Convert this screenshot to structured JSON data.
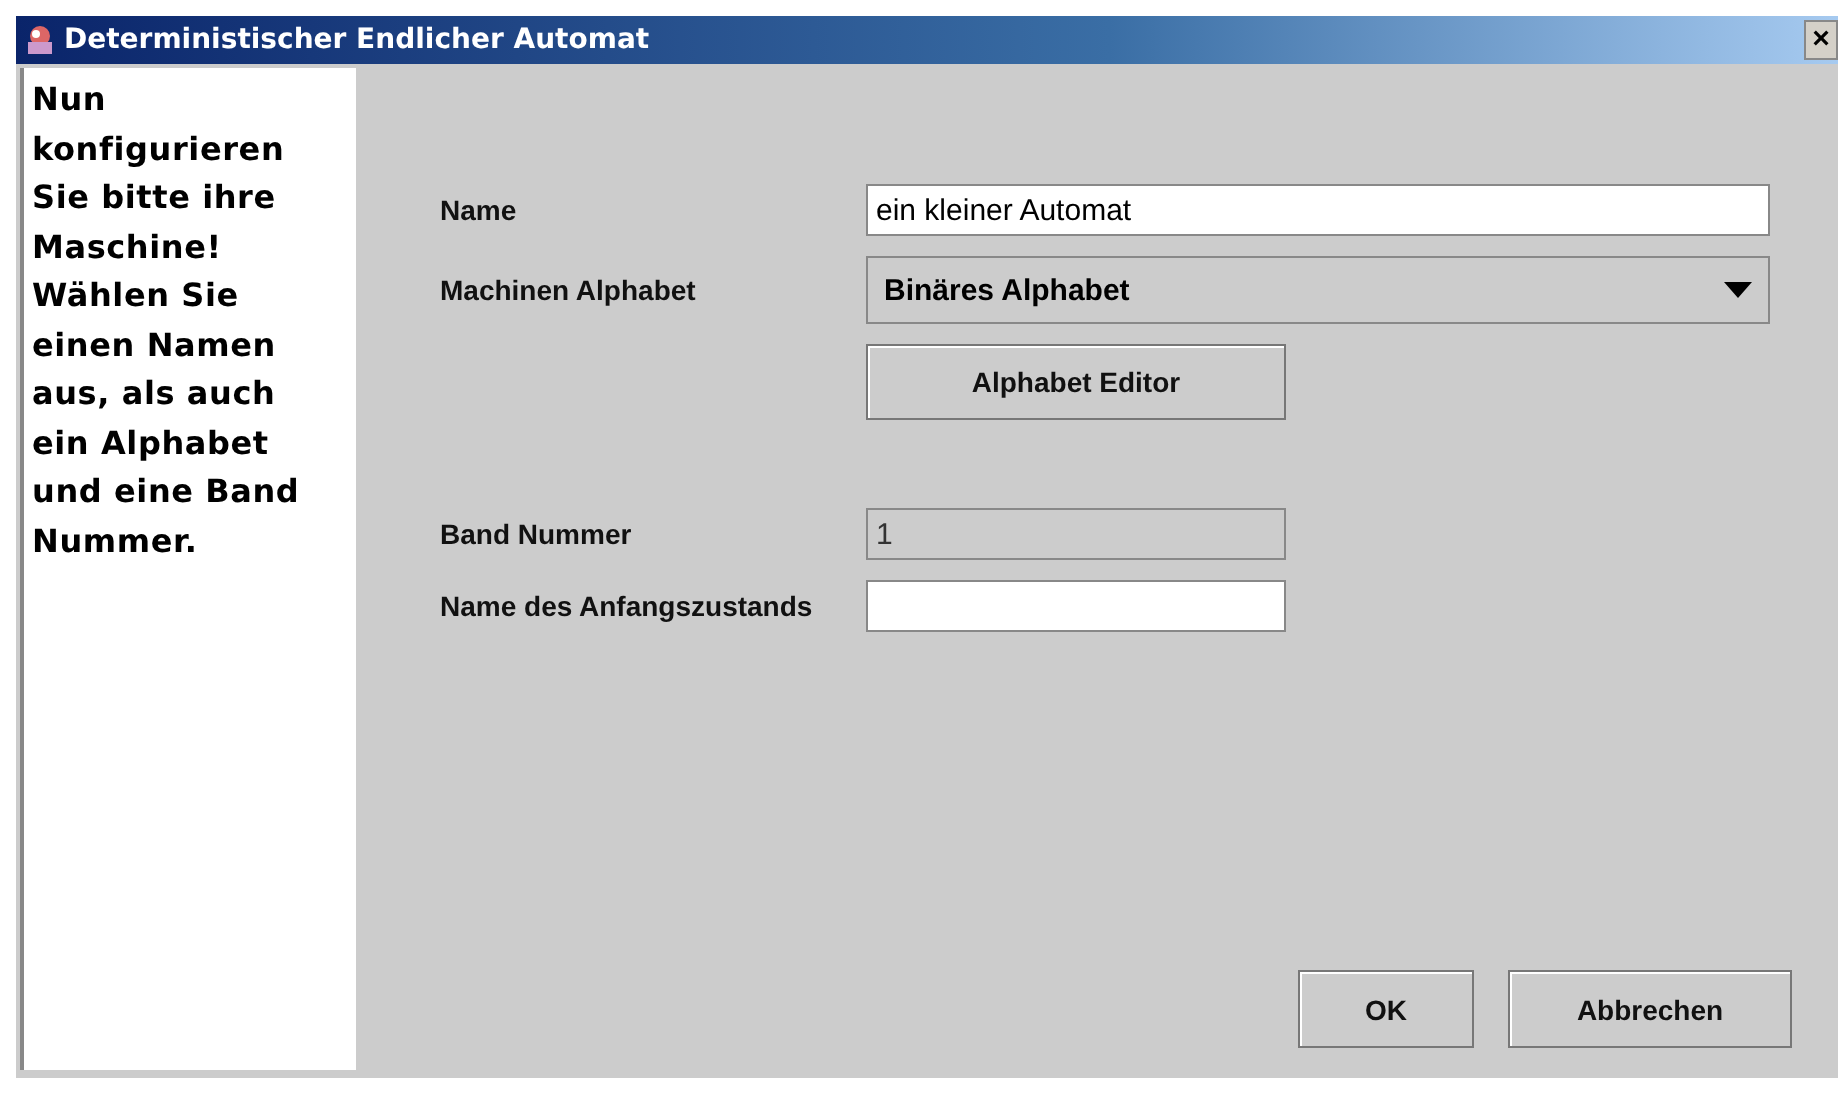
{
  "window": {
    "title": "Deterministischer Endlicher Automat",
    "close": "×"
  },
  "instructions": "Nun konfigurieren Sie bitte ihre Maschine! Wählen Sie einen Namen aus, als auch ein Alphabet und eine Band Nummer.",
  "form": [
    {
      "kind": "text",
      "label": "Name",
      "value": "ein kleiner Automat",
      "disabled": false
    },
    {
      "kind": "dropdown",
      "label": "Machinen Alphabet",
      "value": "Binäres Alphabet"
    },
    {
      "kind": "button",
      "label": "Alphabet Editor"
    },
    {
      "kind": "text",
      "label": "Band Nummer",
      "value": "1",
      "disabled": true
    },
    {
      "kind": "text",
      "label": "Name des Anfangszustands",
      "disabled": false
    }
  ],
  "buttons": [
    "OK",
    "Abbrechen"
  ]
}
